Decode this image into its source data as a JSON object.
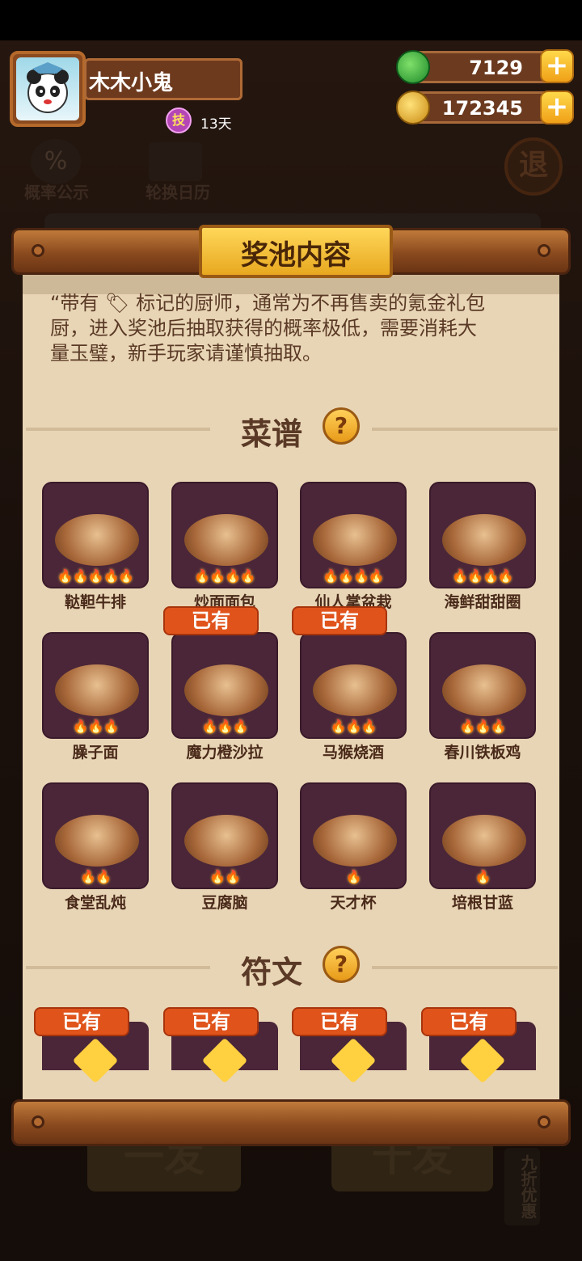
{
  "header": {
    "player_name": "木木小鬼",
    "skill_badge": "技",
    "days": "13天",
    "jade_amount": "7129",
    "coin_amount": "172345",
    "plus": "+"
  },
  "background": {
    "rate_label": "概率公示",
    "rate_icon": "%",
    "calendar_label": "轮换日历",
    "exit_label": "退",
    "single_draw": "一发",
    "ten_draw": "十发",
    "discount": "九折优惠"
  },
  "panel": {
    "title": "奖池内容",
    "description": "带有 标记的厨师，通常为不再曾奖的氪金礼包厨，进入奖池后抽取获得的概率极低，需要消耗大量玉璧，新手玩家请谨慎抽取。",
    "desc_line1": "“带有 🏷 标记的厨师，通常为不再售卖的氪金礼包",
    "desc_line2": "厨，进入奖池后抽取获得的概率极低，需要消耗大",
    "desc_line3": "量玉璧，新手玩家请谨慎抽取。",
    "recipes_title": "菜谱",
    "runes_title": "符文",
    "help": "?",
    "owned_label": "已有"
  },
  "recipes": [
    {
      "name": "鞑靼牛排",
      "flames": "🔥🔥🔥🔥🔥",
      "owned": false
    },
    {
      "name": "炒面面包",
      "flames": "🔥🔥🔥🔥",
      "owned": false
    },
    {
      "name": "仙人掌盆栽",
      "flames": "🔥🔥🔥🔥",
      "owned": false
    },
    {
      "name": "海鲜甜甜圈",
      "flames": "🔥🔥🔥🔥",
      "owned": false
    },
    {
      "name": "臊子面",
      "flames": "🔥🔥🔥",
      "owned": false
    },
    {
      "name": "魔力橙沙拉",
      "flames": "🔥🔥🔥",
      "owned": true
    },
    {
      "name": "马猴烧酒",
      "flames": "🔥🔥🔥",
      "owned": true
    },
    {
      "name": "春川铁板鸡",
      "flames": "🔥🔥🔥",
      "owned": false
    },
    {
      "name": "食堂乱炖",
      "flames": "🔥🔥",
      "owned": false
    },
    {
      "name": "豆腐脑",
      "flames": "🔥🔥",
      "owned": false
    },
    {
      "name": "天才杯",
      "flames": "🔥",
      "owned": false
    },
    {
      "name": "培根甘蓝",
      "flames": "🔥",
      "owned": false
    }
  ],
  "runes": [
    {
      "owned": true
    },
    {
      "owned": true
    },
    {
      "owned": true
    },
    {
      "owned": true
    }
  ],
  "colors": {
    "paper": "#e8d5b5",
    "card": "#4a2638",
    "owned_tag": "#e0541c",
    "title_gold": "#f5c030"
  }
}
